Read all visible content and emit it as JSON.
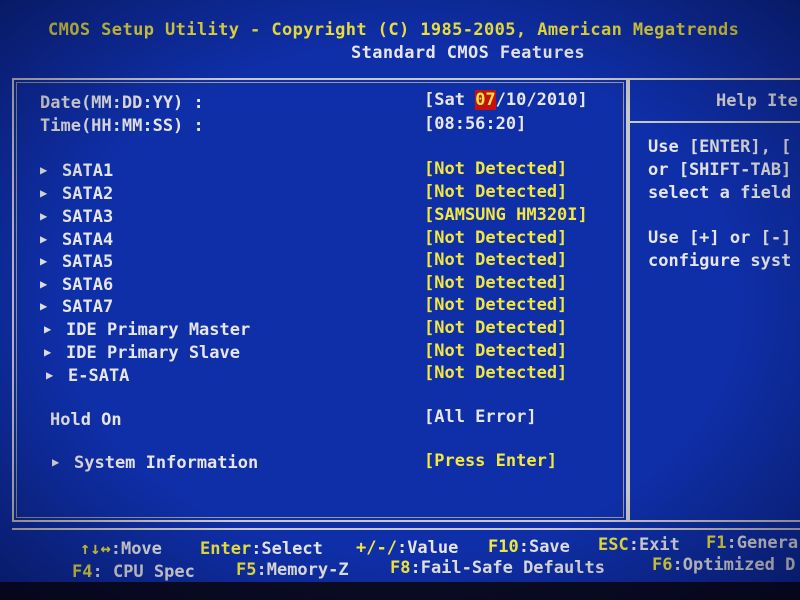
{
  "header": {
    "title": "CMOS Setup Utility - Copyright (C) 1985-2005, American Megatrends",
    "subtitle": "Standard CMOS Features"
  },
  "settings": {
    "date": {
      "label": "Date(MM:DD:YY) :",
      "value_prefix": "[Sat ",
      "value_selected": "07",
      "value_suffix": "/10/2010]"
    },
    "time": {
      "label": "Time(HH:MM:SS) :",
      "value": "[08:56:20]"
    },
    "devices": [
      {
        "label": "SATA1",
        "value": "[Not Detected]"
      },
      {
        "label": "SATA2",
        "value": "[Not Detected]"
      },
      {
        "label": "SATA3",
        "value": "[SAMSUNG HM320I]"
      },
      {
        "label": "SATA4",
        "value": "[Not Detected]"
      },
      {
        "label": "SATA5",
        "value": "[Not Detected]"
      },
      {
        "label": "SATA6",
        "value": "[Not Detected]"
      },
      {
        "label": "SATA7",
        "value": "[Not Detected]"
      },
      {
        "label": "IDE Primary Master",
        "value": "[Not Detected]"
      },
      {
        "label": "IDE Primary Slave",
        "value": "[Not Detected]"
      },
      {
        "label": "E-SATA",
        "value": "[Not Detected]"
      }
    ],
    "hold_on": {
      "label": "Hold On",
      "value": "[All Error]"
    },
    "system_info": {
      "label": "System Information",
      "value": "[Press Enter]"
    }
  },
  "help": {
    "title": "Help Ite",
    "lines": [
      "Use [ENTER], [",
      "or [SHIFT-TAB]",
      "select a field",
      "",
      "Use [+] or [-]",
      "configure syst"
    ]
  },
  "footer": {
    "line1": [
      {
        "key": "↑↓↔",
        "desc": ":Move"
      },
      {
        "key": "Enter",
        "desc": ":Select"
      },
      {
        "key": "+/-/",
        "desc": ":Value"
      },
      {
        "key": "F10",
        "desc": ":Save"
      },
      {
        "key": "ESC",
        "desc": ":Exit"
      },
      {
        "key": "F1",
        "desc": ":Genera"
      }
    ],
    "line2": [
      {
        "key": "F4",
        "desc": ": CPU Spec"
      },
      {
        "key": "F5",
        "desc": ":Memory-Z"
      },
      {
        "key": "F8",
        "desc": ":Fail-Safe Defaults"
      },
      {
        "key": "F6",
        "desc": ":Optimized D"
      }
    ]
  },
  "colors": {
    "background": "#0f2fa8",
    "value_text": "#f2e840",
    "label_text": "#e6e6e6",
    "selected_bg": "#c41010"
  }
}
